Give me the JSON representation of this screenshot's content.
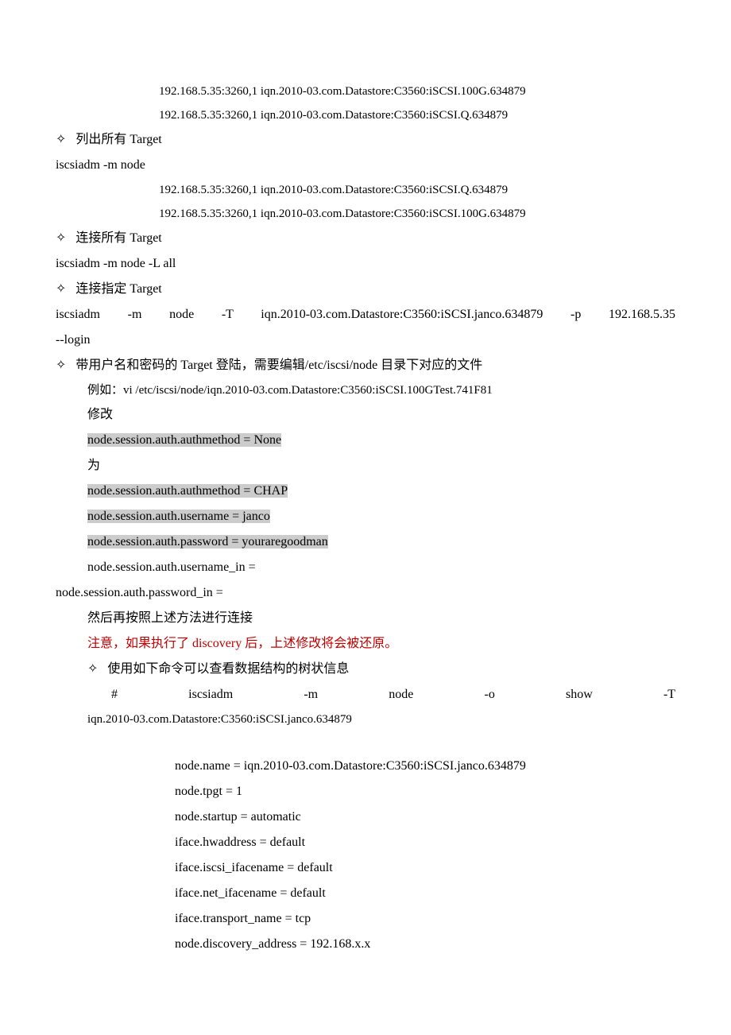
{
  "lines": {
    "l1": "192.168.5.35:3260,1 iqn.2010-03.com.Datastore:C3560:iSCSI.100G.634879",
    "l2": "192.168.5.35:3260,1 iqn.2010-03.com.Datastore:C3560:iSCSI.Q.634879",
    "l3": "列出所有 Target",
    "l4": "iscsiadm -m node",
    "l5": "192.168.5.35:3260,1 iqn.2010-03.com.Datastore:C3560:iSCSI.Q.634879",
    "l6": "192.168.5.35:3260,1 iqn.2010-03.com.Datastore:C3560:iSCSI.100G.634879",
    "l7": "连接所有 Target",
    "l8": "iscsiadm -m node -L all",
    "l9": "连接指定 Target",
    "l10a": "iscsiadm  -m  node  -T  iqn.2010-03.com.Datastore:C3560:iSCSI.janco.634879  -p  192.168.5.35",
    "l10b": "--login",
    "l11": "带用户名和密码的 Target 登陆，需要编辑/etc/iscsi/node 目录下对应的文件",
    "l12": "例如：vi /etc/iscsi/node/iqn.2010-03.com.Datastore:C3560:iSCSI.100GTest.741F81",
    "l13": "修改",
    "l14": "node.session.auth.authmethod = None",
    "l15": "为",
    "l16": "node.session.auth.authmethod = CHAP",
    "l17": "node.session.auth.username = janco",
    "l18": "node.session.auth.password = youraregoodman",
    "l19": "node.session.auth.username_in =",
    "l20": "node.session.auth.password_in =",
    "l21": "然后再按照上述方法进行连接",
    "l22": "注意，如果执行了 discovery 后，上述修改将会被还原。",
    "l23": "使用如下命令可以查看数据结构的树状信息",
    "l24row": [
      "#",
      "iscsiadm",
      "-m",
      "node",
      "-o",
      "show",
      "-T"
    ],
    "l25": "iqn.2010-03.com.Datastore:C3560:iSCSI.janco.634879",
    "o1": "node.name = iqn.2010-03.com.Datastore:C3560:iSCSI.janco.634879",
    "o2": "node.tpgt = 1",
    "o3": "node.startup = automatic",
    "o4": "iface.hwaddress = default",
    "o5": "iface.iscsi_ifacename = default",
    "o6": "iface.net_ifacename = default",
    "o7": "iface.transport_name = tcp",
    "o8": "node.discovery_address = 192.168.x.x"
  }
}
